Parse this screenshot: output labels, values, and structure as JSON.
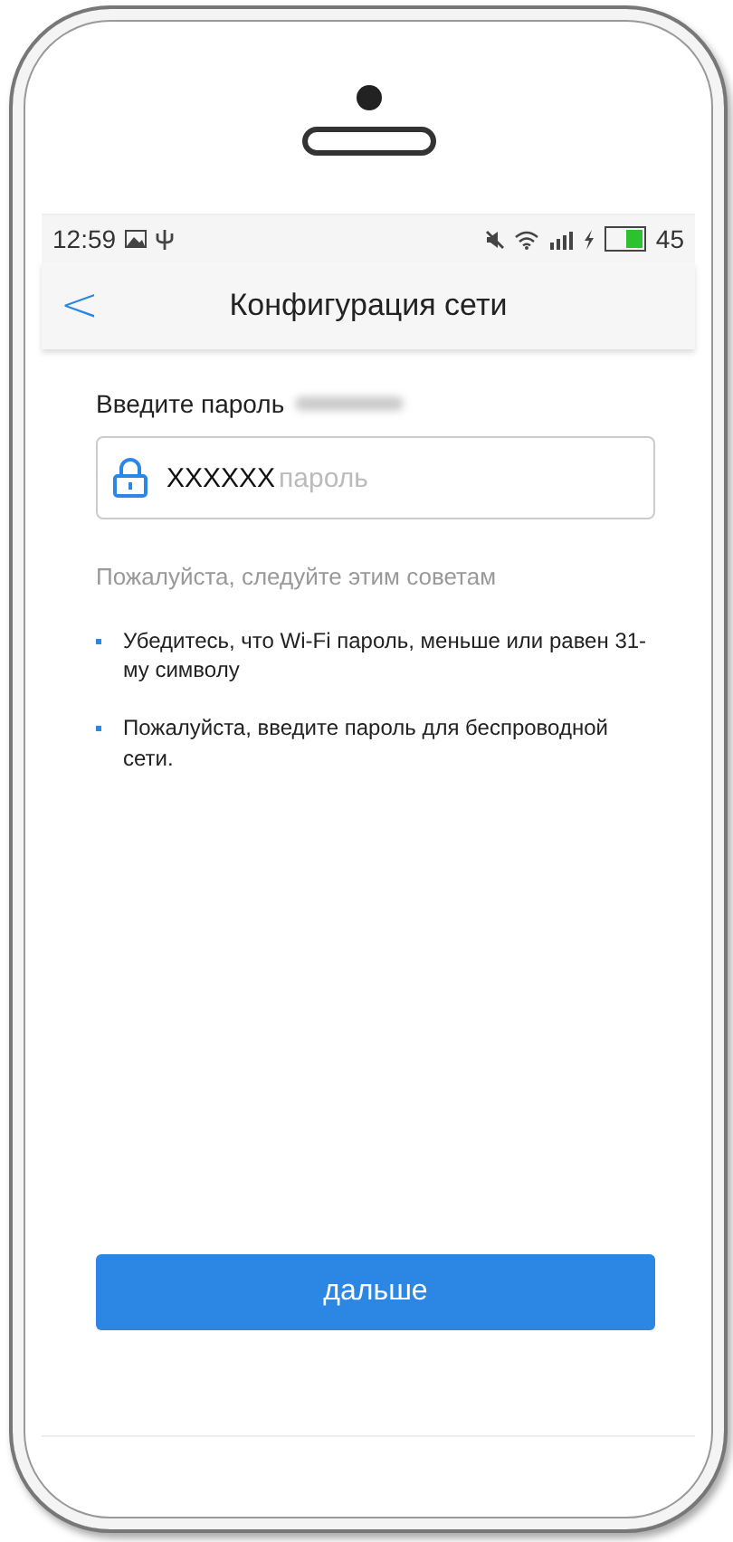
{
  "status_bar": {
    "time": "12:59",
    "battery": {
      "level": 0.5,
      "reading": "45"
    }
  },
  "header": {
    "back": "<",
    "title": "Конфигурация сети"
  },
  "password_label": "Введите пароль",
  "password_field": {
    "value": "XXXXXX",
    "placeholder": "пароль"
  },
  "tips_heading": "Пожалуйста, следуйте этим советам",
  "tips": [
    "Убедитесь, что Wi-Fi пароль, меньше или равен 31-му символу",
    "Пожалуйста, введите пароль для беспроводной сети."
  ],
  "next_button": "дальше"
}
